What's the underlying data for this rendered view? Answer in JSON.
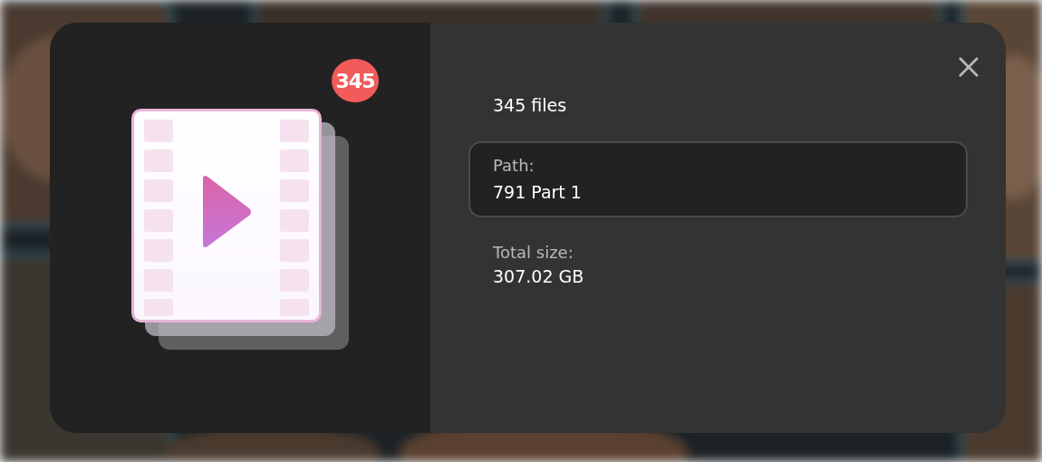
{
  "badge": "345",
  "summary": "345 files",
  "path": {
    "label": "Path:",
    "value": "791 Part 1"
  },
  "total_size": {
    "label": "Total size:",
    "value": "307.02 GB"
  }
}
